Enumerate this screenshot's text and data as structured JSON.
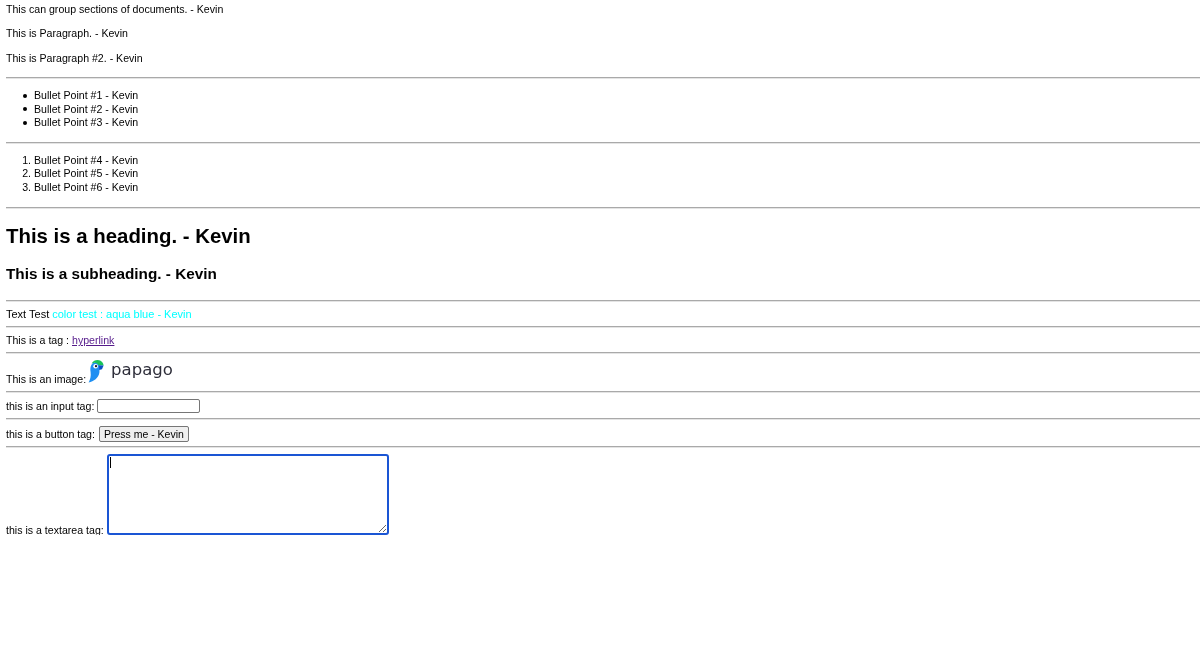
{
  "intro": "This can group sections of documents. - Kevin",
  "paragraphs": [
    "This is Paragraph. - Kevin",
    "This is Paragraph #2. - Kevin"
  ],
  "bullet_list": [
    "Bullet Point #1 - Kevin",
    "Bullet Point #2 - Kevin",
    "Bullet Point #3 - Kevin"
  ],
  "numbered_list": [
    {
      "number": "1.",
      "text": "Bullet Point #4 - Kevin"
    },
    {
      "number": "2.",
      "text": "Bullet Point #5 - Kevin"
    },
    {
      "number": "3.",
      "text": "Bullet Point #6 - Kevin"
    }
  ],
  "heading": "This is a heading. - Kevin",
  "subheading": "This is a subheading. - Kevin",
  "color_line": {
    "segments": [
      {
        "text": "Text Test",
        "color": "#000000"
      },
      {
        "text": "color test : aqua blue - Kevin",
        "color": "#00ffff"
      }
    ]
  },
  "link_line": {
    "label": "This is a tag :",
    "link": {
      "text": "hyperlink",
      "visited": true
    }
  },
  "image_line": {
    "label": "This is an image:",
    "logo_text": "papago"
  },
  "input_line": {
    "label": "this is an input tag:"
  },
  "button_line": {
    "label": "this is a button tag:",
    "button": "Press me - Kevin"
  },
  "textarea_line": {
    "label": "this is a textarea tag:",
    "focused": true
  }
}
